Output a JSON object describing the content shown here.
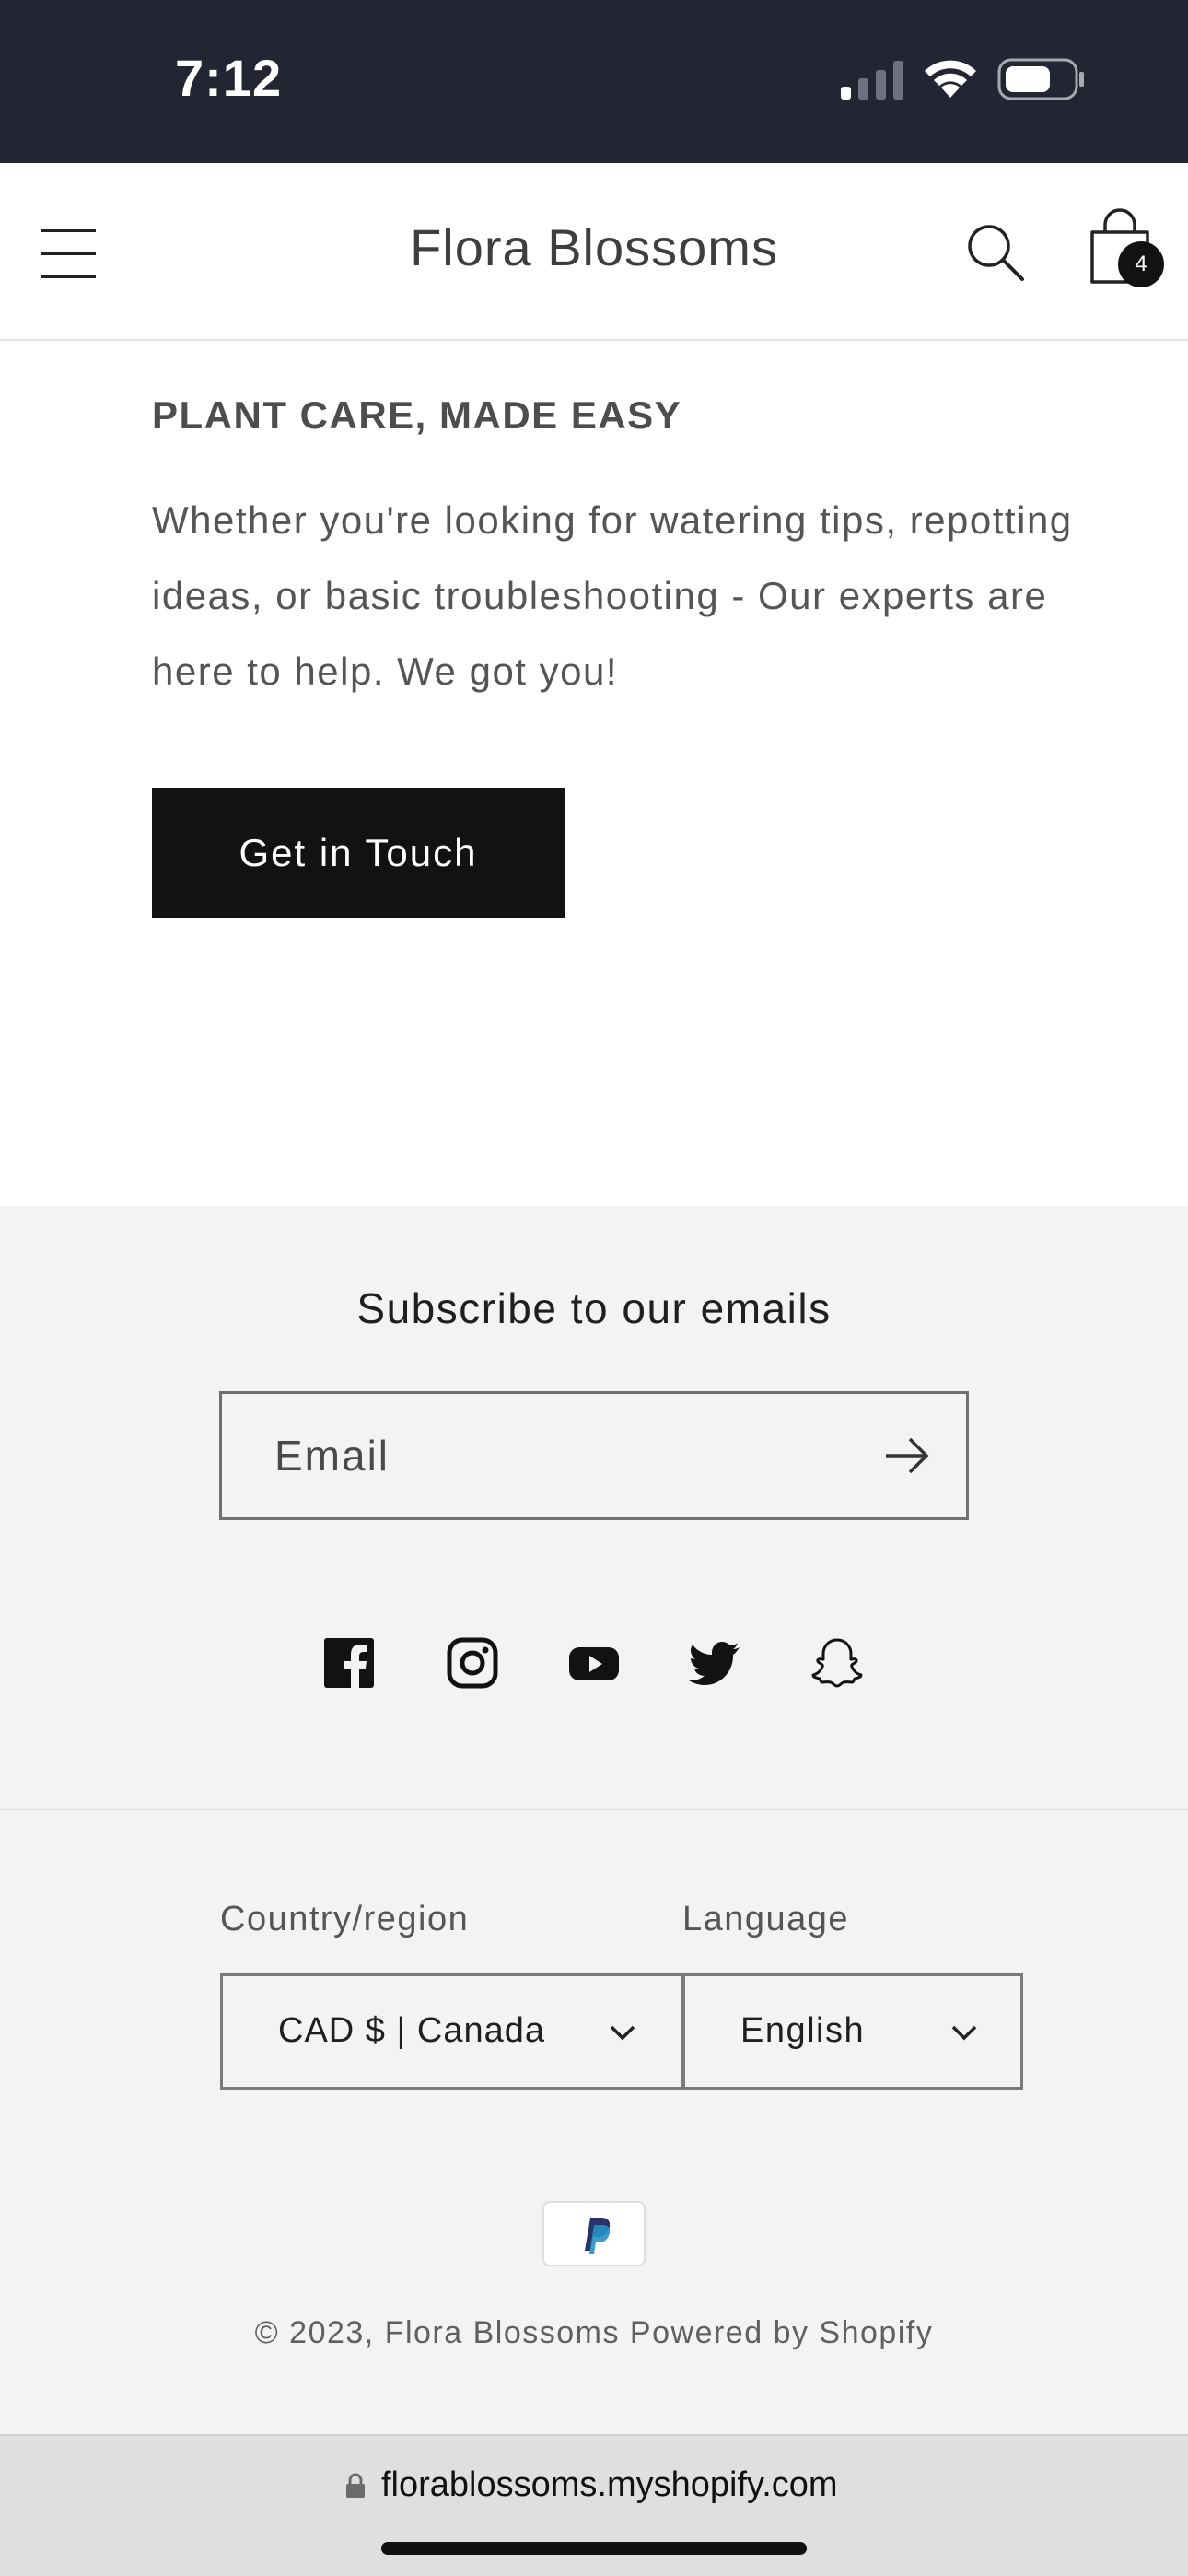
{
  "status_bar": {
    "time": "7:12",
    "icons": [
      "signal-icon",
      "wifi-icon",
      "battery-icon"
    ]
  },
  "header": {
    "store_name": "Flora Blossoms",
    "cart_count": "4",
    "icons": [
      "menu-icon",
      "search-icon",
      "cart-icon"
    ]
  },
  "care_section": {
    "heading": "PLANT CARE, MADE EASY",
    "text": "Whether you're looking for watering tips, repotting ideas, or basic troubleshooting - Our experts are here to help.  We got you!",
    "button_label": "Get in Touch"
  },
  "newsletter": {
    "title": "Subscribe to our emails",
    "email_placeholder": "Email"
  },
  "social_icons": [
    "facebook-icon",
    "instagram-icon",
    "youtube-icon",
    "twitter-icon",
    "snapchat-icon"
  ],
  "localization": {
    "country_label": "Country/region",
    "country_value": "CAD $ | Canada",
    "language_label": "Language",
    "language_value": "English"
  },
  "payment_icons": [
    "paypal-icon"
  ],
  "copyright": "© 2023, Flora Blossoms Powered by Shopify",
  "browser": {
    "url": "florablossoms.myshopify.com"
  },
  "colors": {
    "status_bar_bg": "#232533",
    "button_bg": "#121212",
    "footer_bg": "#f3f3f3",
    "url_bar_bg": "#dedfe1"
  }
}
